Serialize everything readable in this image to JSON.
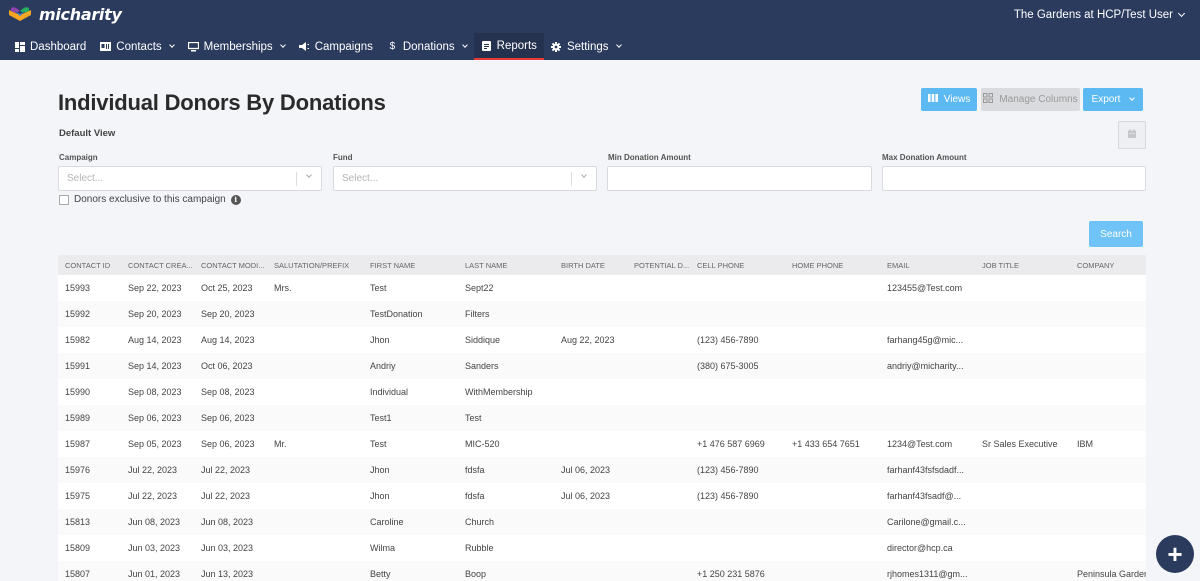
{
  "app": {
    "brand": "micharity",
    "user_menu": "The Gardens at HCP/Test User"
  },
  "nav": [
    {
      "label": "Dashboard",
      "icon": "dashboard-icon",
      "dropdown": false
    },
    {
      "label": "Contacts",
      "icon": "contact-card-icon",
      "dropdown": true
    },
    {
      "label": "Memberships",
      "icon": "monitor-icon",
      "dropdown": true
    },
    {
      "label": "Campaigns",
      "icon": "megaphone-icon",
      "dropdown": false
    },
    {
      "label": "Donations",
      "icon": "dollar-icon",
      "dropdown": true
    },
    {
      "label": "Reports",
      "icon": "report-icon",
      "dropdown": false,
      "active": true
    },
    {
      "label": "Settings",
      "icon": "gear-icon",
      "dropdown": true
    }
  ],
  "page": {
    "title": "Individual Donors By Donations",
    "view_label": "Default View",
    "views_button": "Views",
    "manage_columns_button": "Manage Columns",
    "export_button": "Export",
    "search_button": "Search"
  },
  "filters": {
    "campaign": {
      "label": "Campaign",
      "placeholder": "Select..."
    },
    "fund": {
      "label": "Fund",
      "placeholder": "Select..."
    },
    "min_amount": {
      "label": "Min Donation Amount",
      "value": ""
    },
    "max_amount": {
      "label": "Max Donation Amount",
      "value": ""
    },
    "exclusive_checkbox": {
      "label": "Donors exclusive to this campaign",
      "checked": false
    }
  },
  "colors": {
    "navbar": "#2b3b5e",
    "primary_button": "#5cb9f2",
    "active_tab_underline": "#e53935"
  },
  "table": {
    "columns": [
      "Contact ID",
      "Contact Crea...",
      "Contact Modi...",
      "Salutation/Prefix",
      "First Name",
      "Last Name",
      "Birth Date",
      "Potential D...",
      "Cell Phone",
      "Home Phone",
      "Email",
      "Job Title",
      "Company"
    ],
    "rows": [
      [
        "15993",
        "Sep 22, 2023",
        "Oct 25, 2023",
        "Mrs.",
        "Test",
        "Sept22",
        "",
        "",
        "",
        "",
        "123455@Test.com",
        "",
        ""
      ],
      [
        "15992",
        "Sep 20, 2023",
        "Sep 20, 2023",
        "",
        "TestDonation",
        "Filters",
        "",
        "",
        "",
        "",
        "",
        "",
        ""
      ],
      [
        "15982",
        "Aug 14, 2023",
        "Aug 14, 2023",
        "",
        "Jhon",
        "Siddique",
        "Aug 22, 2023",
        "",
        "(123) 456-7890",
        "",
        "farhang45g@mic...",
        "",
        ""
      ],
      [
        "15991",
        "Sep 14, 2023",
        "Oct 06, 2023",
        "",
        "Andriy",
        "Sanders",
        "",
        "",
        "(380) 675-3005",
        "",
        "andriy@micharity...",
        "",
        ""
      ],
      [
        "15990",
        "Sep 08, 2023",
        "Sep 08, 2023",
        "",
        "Individual",
        "WithMembership",
        "",
        "",
        "",
        "",
        "",
        "",
        ""
      ],
      [
        "15989",
        "Sep 06, 2023",
        "Sep 06, 2023",
        "",
        "Test1",
        "Test",
        "",
        "",
        "",
        "",
        "",
        "",
        ""
      ],
      [
        "15987",
        "Sep 05, 2023",
        "Sep 06, 2023",
        "Mr.",
        "Test",
        "MIC-520",
        "",
        "",
        "+1 476 587 6969",
        "+1 433 654 7651",
        "1234@Test.com",
        "Sr Sales Executive",
        "IBM"
      ],
      [
        "15976",
        "Jul 22, 2023",
        "Jul 22, 2023",
        "",
        "Jhon",
        "fdsfa",
        "Jul 06, 2023",
        "",
        "(123) 456-7890",
        "",
        "farhanf43fsfsdadf...",
        "",
        ""
      ],
      [
        "15975",
        "Jul 22, 2023",
        "Jul 22, 2023",
        "",
        "Jhon",
        "fdsfa",
        "Jul 06, 2023",
        "",
        "(123) 456-7890",
        "",
        "farhanf43fsadf@...",
        "",
        ""
      ],
      [
        "15813",
        "Jun 08, 2023",
        "Jun 08, 2023",
        "",
        "Caroline",
        "Church",
        "",
        "",
        "",
        "",
        "Carilone@gmail.c...",
        "",
        ""
      ],
      [
        "15809",
        "Jun 03, 2023",
        "Jun 03, 2023",
        "",
        "Wilma",
        "Rubble",
        "",
        "",
        "",
        "",
        "director@hcp.ca",
        "",
        ""
      ],
      [
        "15807",
        "Jun 01, 2023",
        "Jun 13, 2023",
        "",
        "Betty",
        "Boop",
        "",
        "",
        "+1 250 231 5876",
        "",
        "rjhomes1311@gm...",
        "",
        "Peninsula Garden"
      ]
    ]
  },
  "fab": {
    "label": "+",
    "icon": "plus-icon"
  }
}
